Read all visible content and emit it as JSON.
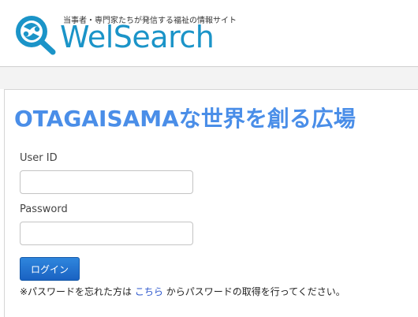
{
  "header": {
    "tagline": "当事者・専門家たちが発信する福祉の情報サイト",
    "logo_text": "WelSearch"
  },
  "colors": {
    "brand": "#1b94c8",
    "title": "#4a8ee8",
    "button": "#1a62c2",
    "link": "#2a55cc"
  },
  "main": {
    "title": "OTAGAISAMAな世界を創る広場",
    "user_id_label": "User ID",
    "user_id_value": "",
    "password_label": "Password",
    "password_value": "",
    "login_button": "ログイン",
    "help_prefix": "※パスワードを忘れた方は",
    "help_link": "こちら",
    "help_suffix": "からパスワードの取得を行ってください。"
  }
}
